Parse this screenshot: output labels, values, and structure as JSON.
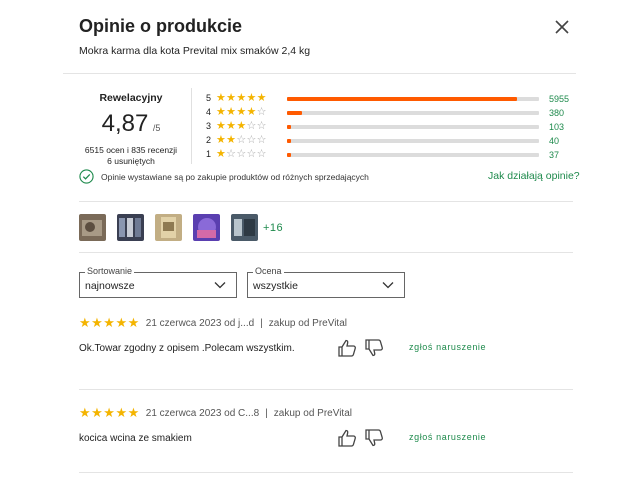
{
  "header": {
    "title": "Opinie o produkcie",
    "subtitle": "Mokra karma dla kota Prevital mix smaków 2,4 kg"
  },
  "summary": {
    "verdict": "Rewelacyjny",
    "score": "4,87",
    "score_max": "/5",
    "counts_line1": "6515 ocen i 835 recenzji",
    "counts_line2": "6 usuniętych"
  },
  "distribution": [
    {
      "stars": "5",
      "count": "5955",
      "fraction": 0.914
    },
    {
      "stars": "4",
      "count": "380",
      "fraction": 0.058
    },
    {
      "stars": "3",
      "count": "103",
      "fraction": 0.016
    },
    {
      "stars": "2",
      "count": "40",
      "fraction": 0.006
    },
    {
      "stars": "1",
      "count": "37",
      "fraction": 0.006
    }
  ],
  "verified": {
    "text": "Opinie wystawiane są po zakupie produktów od różnych sprzedających",
    "link": "Jak działają opinie?"
  },
  "photos": {
    "more_label": "+16"
  },
  "filters": {
    "sort_label": "Sortowanie",
    "sort_value": "najnowsze",
    "rating_label": "Ocena",
    "rating_value": "wszystkie"
  },
  "reviews": [
    {
      "rating": 5,
      "meta": "21 czerwca 2023 od j...d",
      "source": "zakup od PreVital",
      "text": "Ok.Towar zgodny z opisem .Polecam wszystkim.",
      "report": "zgłoś naruszenie"
    },
    {
      "rating": 5,
      "meta": "21 czerwca 2023 od C...8",
      "source": "zakup od PreVital",
      "text": "kocica wcina ze smakiem",
      "report": "zgłoś naruszenie"
    }
  ],
  "colors": {
    "accent_green": "#1e8a4c",
    "bar_orange": "#ff5a00",
    "star_yellow": "#f4b400"
  }
}
